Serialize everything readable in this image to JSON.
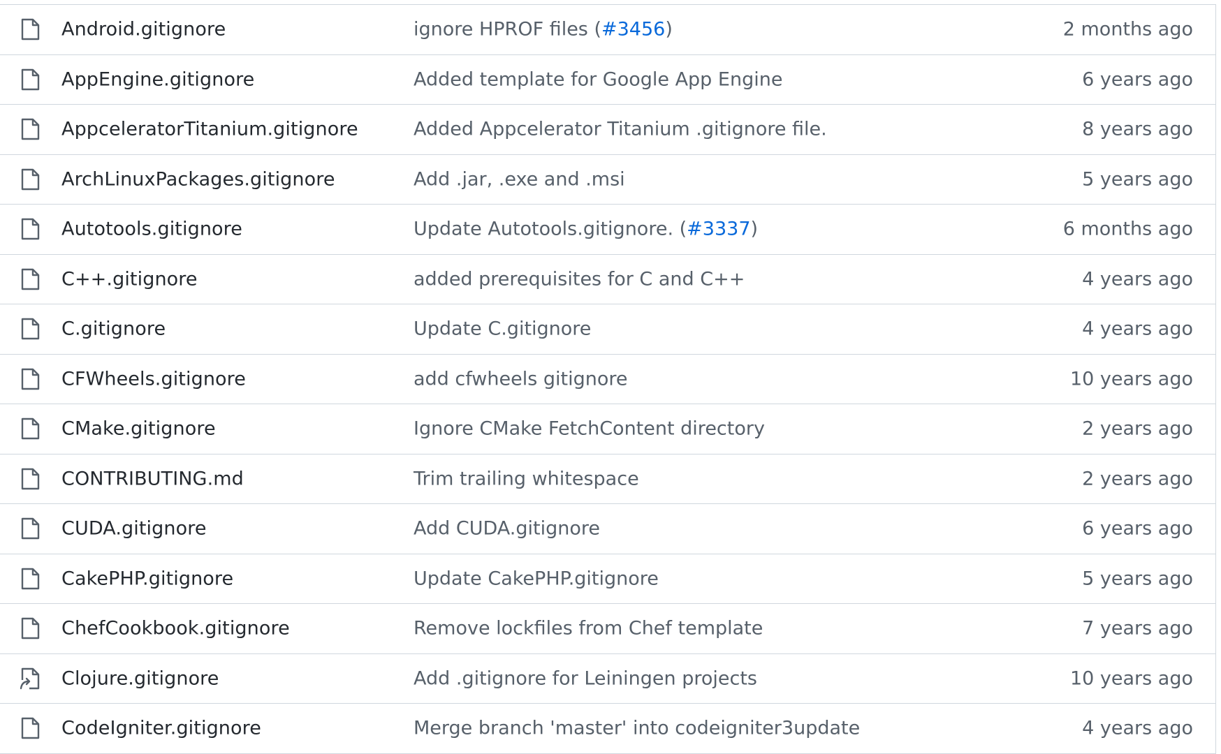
{
  "files": [
    {
      "name": "Android.gitignore",
      "icon": "file-icon",
      "message": "ignore HPROF files (",
      "pr": "#3456",
      "message_end": ")",
      "age": "2 months ago"
    },
    {
      "name": "AppEngine.gitignore",
      "icon": "file-icon",
      "message": "Added template for Google App Engine",
      "pr": "",
      "message_end": "",
      "age": "6 years ago"
    },
    {
      "name": "AppceleratorTitanium.gitignore",
      "icon": "file-icon",
      "message": "Added Appcelerator Titanium .gitignore file.",
      "pr": "",
      "message_end": "",
      "age": "8 years ago"
    },
    {
      "name": "ArchLinuxPackages.gitignore",
      "icon": "file-icon",
      "message": "Add .jar, .exe and .msi",
      "pr": "",
      "message_end": "",
      "age": "5 years ago"
    },
    {
      "name": "Autotools.gitignore",
      "icon": "file-icon",
      "message": "Update Autotools.gitignore. (",
      "pr": "#3337",
      "message_end": ")",
      "age": "6 months ago"
    },
    {
      "name": "C++.gitignore",
      "icon": "file-icon",
      "message": "added prerequisites for C and C++",
      "pr": "",
      "message_end": "",
      "age": "4 years ago"
    },
    {
      "name": "C.gitignore",
      "icon": "file-icon",
      "message": "Update C.gitignore",
      "pr": "",
      "message_end": "",
      "age": "4 years ago"
    },
    {
      "name": "CFWheels.gitignore",
      "icon": "file-icon",
      "message": "add cfwheels gitignore",
      "pr": "",
      "message_end": "",
      "age": "10 years ago"
    },
    {
      "name": "CMake.gitignore",
      "icon": "file-icon",
      "message": "Ignore CMake FetchContent directory",
      "pr": "",
      "message_end": "",
      "age": "2 years ago"
    },
    {
      "name": "CONTRIBUTING.md",
      "icon": "file-icon",
      "message": "Trim trailing whitespace",
      "pr": "",
      "message_end": "",
      "age": "2 years ago"
    },
    {
      "name": "CUDA.gitignore",
      "icon": "file-icon",
      "message": "Add CUDA.gitignore",
      "pr": "",
      "message_end": "",
      "age": "6 years ago"
    },
    {
      "name": "CakePHP.gitignore",
      "icon": "file-icon",
      "message": "Update CakePHP.gitignore",
      "pr": "",
      "message_end": "",
      "age": "5 years ago"
    },
    {
      "name": "ChefCookbook.gitignore",
      "icon": "file-icon",
      "message": "Remove lockfiles from Chef template",
      "pr": "",
      "message_end": "",
      "age": "7 years ago"
    },
    {
      "name": "Clojure.gitignore",
      "icon": "file-symlink-icon",
      "message": "Add .gitignore for Leiningen projects",
      "pr": "",
      "message_end": "",
      "age": "10 years ago"
    },
    {
      "name": "CodeIgniter.gitignore",
      "icon": "file-icon",
      "message": "Merge branch 'master' into codeigniter3update",
      "pr": "",
      "message_end": "",
      "age": "4 years ago"
    }
  ],
  "colors": {
    "border": "#d0d7de",
    "text": "#24292f",
    "muted": "#57606a",
    "link": "#0969da"
  }
}
